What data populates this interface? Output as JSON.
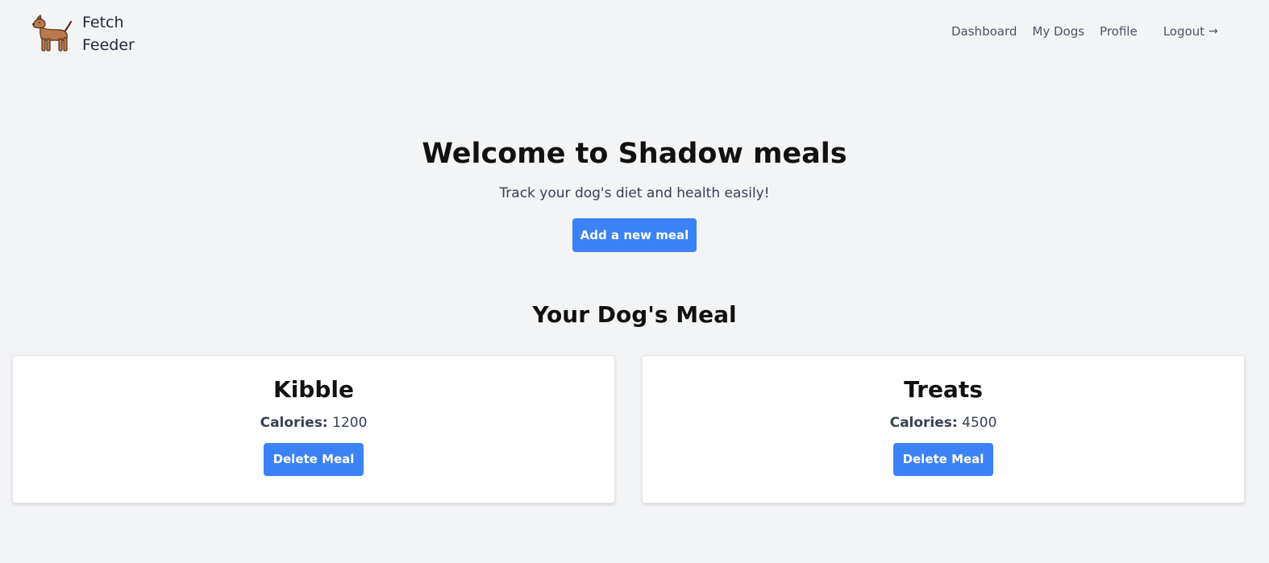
{
  "brand": {
    "line1": "Fetch",
    "line2": "Feeder",
    "logo_icon": "dog-icon"
  },
  "nav": {
    "dashboard": "Dashboard",
    "my_dogs": "My Dogs",
    "profile": "Profile",
    "logout": "Logout",
    "logout_icon": "arrow-right-icon"
  },
  "hero": {
    "title": "Welcome to Shadow meals",
    "subtitle": "Track your dog's diet and health easily!",
    "add_button": "Add a new meal"
  },
  "meals": {
    "title": "Your Dog's Meal",
    "calories_label": "Calories:",
    "items": [
      {
        "name": "Kibble",
        "calories": "1200",
        "delete_label": "Delete Meal"
      },
      {
        "name": "Treats",
        "calories": "4500",
        "delete_label": "Delete Meal"
      }
    ]
  },
  "colors": {
    "accent": "#3b82f6",
    "background": "#f3f4f6",
    "card": "#ffffff"
  }
}
